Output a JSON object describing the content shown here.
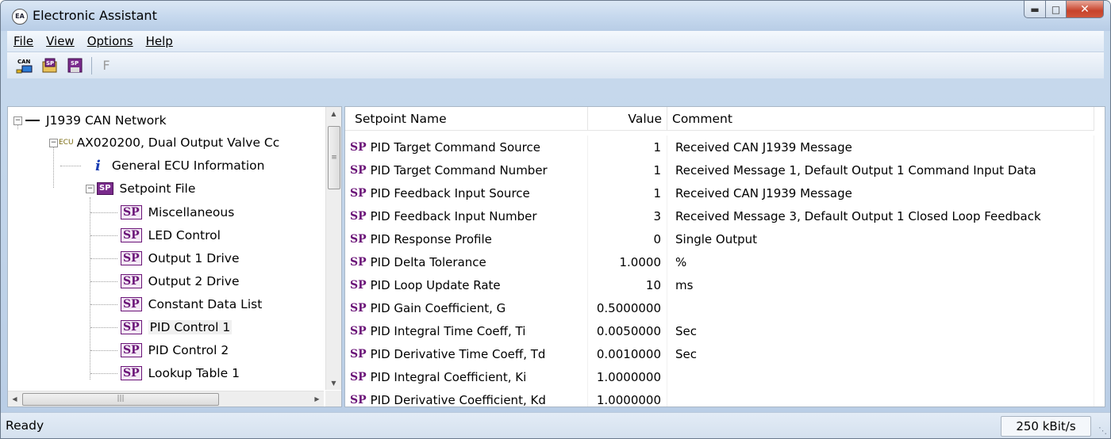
{
  "window": {
    "title": "Electronic Assistant",
    "app_icon_text": "EA"
  },
  "menu": [
    "File",
    "View",
    "Options",
    "Help"
  ],
  "toolbar": {
    "can_label": "CAN",
    "sp_label": "SP",
    "f_label": "F"
  },
  "tree": {
    "network": "J1939 CAN Network",
    "ecu_tag": "ECU",
    "ecu": "AX020200, Dual Output Valve Cc",
    "general_info": "General ECU Information",
    "setpoint_file": "Setpoint File",
    "sp_icon_label": "SP",
    "items": [
      "Miscellaneous",
      "LED Control",
      "Output 1 Drive",
      "Output 2 Drive",
      "Constant Data List",
      "PID Control 1",
      "PID Control 2",
      "Lookup Table 1"
    ]
  },
  "grid": {
    "columns": {
      "name": "Setpoint Name",
      "value": "Value",
      "comment": "Comment"
    },
    "sp_mark": "SP",
    "rows": [
      {
        "name": "PID Target Command Source",
        "value": "1",
        "comment": "Received CAN J1939 Message"
      },
      {
        "name": "PID Target Command Number",
        "value": "1",
        "comment": "Received Message 1, Default Output 1 Command Input Data"
      },
      {
        "name": "PID Feedback Input Source",
        "value": "1",
        "comment": "Received CAN J1939 Message"
      },
      {
        "name": "PID Feedback Input Number",
        "value": "3",
        "comment": "Received Message 3, Default Output 1 Closed Loop Feedback"
      },
      {
        "name": "PID Response Profile",
        "value": "0",
        "comment": "Single Output"
      },
      {
        "name": "PID Delta Tolerance",
        "value": "1.0000",
        "comment": "%"
      },
      {
        "name": "PID Loop Update Rate",
        "value": "10",
        "comment": "ms"
      },
      {
        "name": "PID Gain Coefficient, G",
        "value": "0.5000000",
        "comment": ""
      },
      {
        "name": "PID Integral Time Coeff, Ti",
        "value": "0.0050000",
        "comment": "Sec"
      },
      {
        "name": "PID Derivative Time Coeff, Td",
        "value": "0.0010000",
        "comment": "Sec"
      },
      {
        "name": "PID Integral Coefficient, Ki",
        "value": "1.0000000",
        "comment": ""
      },
      {
        "name": "PID Derivative Coefficient, Kd",
        "value": "1.0000000",
        "comment": ""
      }
    ]
  },
  "status": {
    "text": "Ready",
    "bitrate": "250 kBit/s"
  }
}
